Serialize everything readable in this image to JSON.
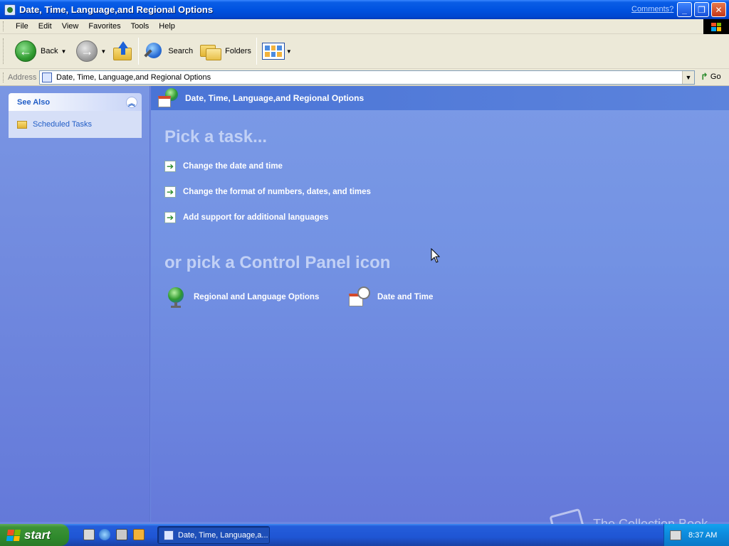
{
  "window": {
    "title": "Date, Time, Language,and Regional Options",
    "comments_link": "Comments?",
    "buttons": {
      "minimize": "_",
      "maximize": "❐",
      "close": "✕"
    }
  },
  "menubar": {
    "items": [
      "File",
      "Edit",
      "View",
      "Favorites",
      "Tools",
      "Help"
    ]
  },
  "toolbar": {
    "back_label": "Back",
    "search_label": "Search",
    "folders_label": "Folders"
  },
  "address": {
    "label": "Address",
    "value": "Date, Time, Language,and Regional Options",
    "go_label": "Go"
  },
  "see_also": {
    "heading": "See Also",
    "items": [
      "Scheduled Tasks"
    ]
  },
  "main": {
    "header_title": "Date, Time, Language,and Regional Options",
    "pick_task_heading": "Pick a task...",
    "tasks": [
      "Change the date and time",
      "Change the format of numbers, dates, and times",
      "Add support for additional languages"
    ],
    "control_panel_heading": "or pick a Control Panel icon",
    "icons": [
      {
        "label": "Regional and Language Options",
        "icon": "globe-icon"
      },
      {
        "label": "Date and Time",
        "icon": "calendar-clock-icon"
      }
    ]
  },
  "taskbar": {
    "start_label": "start",
    "window_button": "Date, Time, Language,a...",
    "clock": "8:37 AM",
    "watermark": "The Collection Book"
  },
  "colors": {
    "title_blue": "#0052e0",
    "pane_blue": "#7392e3",
    "start_green": "#3c9237",
    "link_blue": "#215dc6"
  }
}
